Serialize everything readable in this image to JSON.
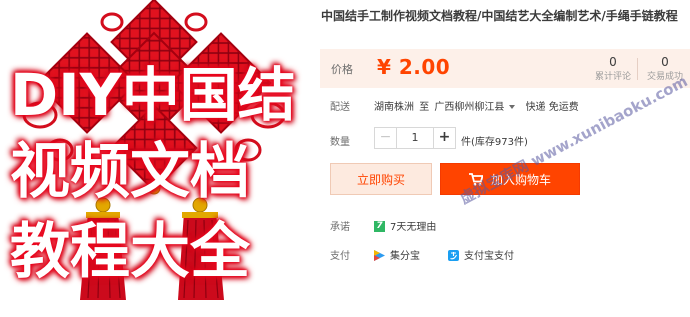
{
  "product_image": {
    "overlay_lines": [
      "DIY中国结",
      "视频文档",
      "教程大全"
    ],
    "knot_color": "#d9101f",
    "tassel_color": "#c9051a"
  },
  "product": {
    "title": "中国结手工制作视频文档教程/中国结艺大全编制艺术/手绳手链教程"
  },
  "price": {
    "label": "价格",
    "value": "¥ 2.00",
    "accent": "#ff4400"
  },
  "stats": {
    "reviews": {
      "count": "0",
      "label": "累计评论"
    },
    "deals": {
      "count": "0",
      "label": "交易成功"
    }
  },
  "shipping": {
    "label": "配送",
    "from": "湖南株洲",
    "to_word": "至",
    "destination": "广西柳州柳江县",
    "express": "快递 免运费"
  },
  "quantity": {
    "label": "数量",
    "minus": "−",
    "value": "1",
    "plus": "+",
    "stock": "件(库存973件)"
  },
  "buttons": {
    "buy_now": "立即购买",
    "add_to_cart": "加入购物车"
  },
  "promise": {
    "label": "承诺",
    "item_icon": "7",
    "item": "7天无理由"
  },
  "payment": {
    "label": "支付",
    "methods": [
      {
        "icon": "jifenbao-icon",
        "name": "集分宝"
      },
      {
        "icon": "alipay-icon",
        "name": "支付宝支付"
      }
    ]
  },
  "watermark": "虚拟宝库网 www.xunibaoku.com"
}
